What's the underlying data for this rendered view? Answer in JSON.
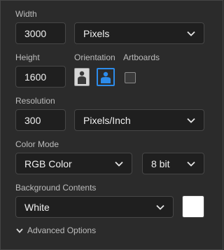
{
  "width": {
    "label": "Width",
    "value": "3000",
    "unit": "Pixels"
  },
  "height": {
    "label": "Height",
    "value": "1600"
  },
  "orientation": {
    "label": "Orientation"
  },
  "artboards": {
    "label": "Artboards",
    "checked": false
  },
  "resolution": {
    "label": "Resolution",
    "value": "300",
    "unit": "Pixels/Inch"
  },
  "color_mode": {
    "label": "Color Mode",
    "mode": "RGB Color",
    "depth": "8 bit"
  },
  "background": {
    "label": "Background Contents",
    "value": "White",
    "swatch_color": "#ffffff"
  },
  "advanced": {
    "label": "Advanced Options"
  },
  "icons": {
    "chevron": "chevron-down-icon",
    "portrait": "portrait-icon",
    "landscape": "landscape-icon"
  },
  "colors": {
    "accent": "#2d8ceb"
  }
}
